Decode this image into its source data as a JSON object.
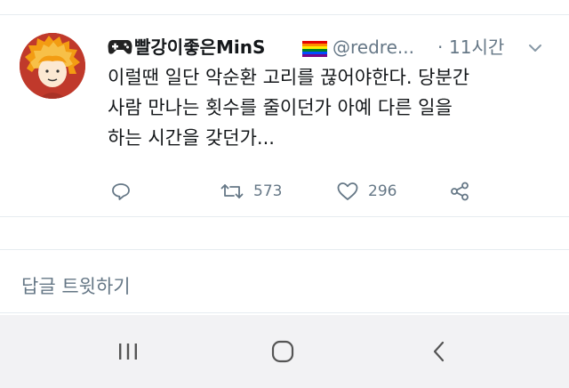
{
  "tweet": {
    "display_name": "빨강이좋은MinS",
    "handle": "@redre...",
    "separator": "·",
    "timestamp": "11시간",
    "text_lines": [
      "이럴땐 일단 악순환 고리를 끊어야한다. 당분간",
      "사람 만나는 횟수를 줄이던가 아예 다른 일을",
      "하는 시간을 갖던가..."
    ],
    "retweet_count": "573",
    "like_count": "296"
  },
  "reply_composer": {
    "placeholder": "답글 트윗하기"
  },
  "icons": {
    "leading_emoji": "gamepad-icon",
    "trailing_emoji": "rainbow-flag-icon",
    "actions": [
      "reply-icon",
      "retweet-icon",
      "like-icon",
      "share-icon"
    ],
    "system_nav": [
      "recents-icon",
      "home-icon",
      "back-icon"
    ]
  },
  "colors": {
    "text_primary": "#14171a",
    "text_secondary": "#657786",
    "divider": "#e6ecf0",
    "avatar_background": "#c0392b",
    "nav_bar": "#f2f2f4"
  }
}
